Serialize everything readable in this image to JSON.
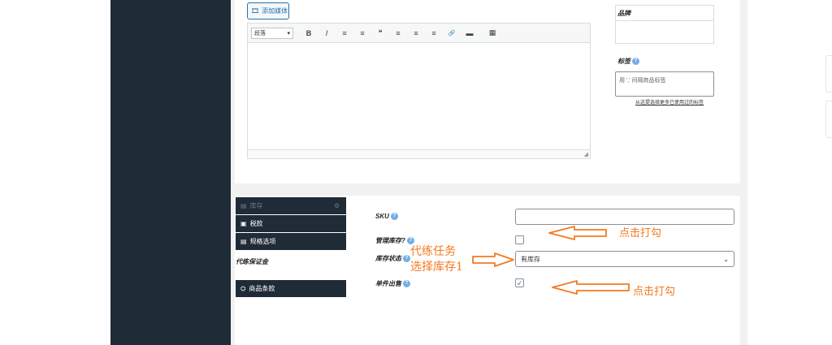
{
  "editor": {
    "add_media_label": "添加媒体",
    "format_select": "段落",
    "toolbar_buttons": [
      "B",
      "I",
      "≡",
      "≡",
      "❝",
      "≡",
      "≡",
      "≡",
      "🔗",
      "▬",
      "▦"
    ]
  },
  "sidebar_boxes": {
    "brand_title": "品牌",
    "tags_title": "标签",
    "tags_placeholder": "用 ',' 间隔商品标签",
    "tags_link": "从这提选择更多已使用过的标签"
  },
  "product_tabs": {
    "inventory": "库存",
    "tax": "税款",
    "variants": "规格选项",
    "warranty": "代练保证金",
    "terms": "商品条款"
  },
  "inventory_fields": {
    "sku_label": "SKU",
    "manage_stock_label": "管理库存?",
    "stock_status_label": "库存状态",
    "stock_status_value": "有库存",
    "sold_individually_label": "单件出售"
  },
  "annotations": {
    "click_check_1": "点击打勾",
    "task_line1": "代练任务",
    "task_line2": "选择库存1",
    "click_check_2": "点击打勾"
  },
  "colors": {
    "sidebar": "#1f2b36",
    "accent": "#2271b1",
    "annotation": "#f47920"
  }
}
